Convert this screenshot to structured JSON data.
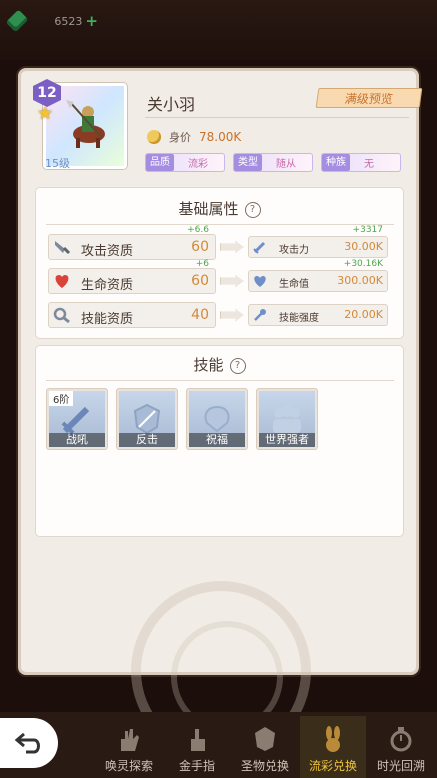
{
  "currency": {
    "amount": "6523",
    "plus_label": "+"
  },
  "hero": {
    "level_badge": "12",
    "level_text": "15级",
    "name": "关小羽",
    "max_preview_label": "满级预览",
    "price_label": "身价",
    "price_value": "78.00K",
    "tags": [
      {
        "key": "品质",
        "value": "流彩"
      },
      {
        "key": "类型",
        "value": "随从"
      },
      {
        "key": "种族",
        "value": "无"
      }
    ]
  },
  "base_attributes": {
    "title": "基础属性",
    "help": "?",
    "rows": [
      {
        "icon": "sword-quality-icon",
        "label": "攻击资质",
        "value": "60",
        "delta": "+6.6",
        "stat_icon": "sword-icon",
        "stat_label": "攻击力",
        "stat_value": "30.00K",
        "stat_delta": "+3317"
      },
      {
        "icon": "heart-quality-icon",
        "label": "生命资质",
        "value": "60",
        "delta": "+6",
        "stat_icon": "heart-icon",
        "stat_label": "生命值",
        "stat_value": "300.00K",
        "stat_delta": "+30.16K"
      },
      {
        "icon": "skill-quality-icon",
        "label": "技能资质",
        "value": "40",
        "delta": "",
        "stat_icon": "magic-icon",
        "stat_label": "技能强度",
        "stat_value": "20.00K",
        "stat_delta": ""
      }
    ]
  },
  "skills": {
    "title": "技能",
    "help": "?",
    "items": [
      {
        "name": "战吼",
        "badge": "6阶",
        "icon": "sword-icon"
      },
      {
        "name": "反击",
        "badge": "",
        "icon": "shield-icon"
      },
      {
        "name": "祝福",
        "badge": "",
        "icon": "blessing-icon"
      },
      {
        "name": "世界强者",
        "badge": "",
        "icon": "crowd-icon"
      }
    ]
  },
  "bottom_nav": {
    "items": [
      {
        "label": "唤灵探索",
        "active": false
      },
      {
        "label": "金手指",
        "active": false
      },
      {
        "label": "圣物兑换",
        "active": false
      },
      {
        "label": "流彩兑换",
        "active": true
      },
      {
        "label": "时光回溯",
        "active": false
      }
    ]
  }
}
